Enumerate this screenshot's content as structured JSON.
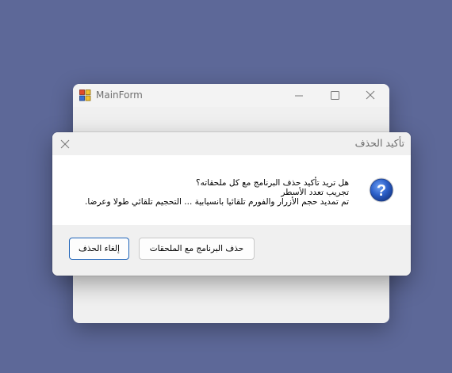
{
  "main_window": {
    "title": "MainForm",
    "icons": {
      "app": "app-icon",
      "minimize": "minimize-icon",
      "maximize": "maximize-icon",
      "close": "close-icon"
    }
  },
  "dialog": {
    "title": "تأكيد الحذف",
    "icon": "question-icon",
    "close_icon": "close-icon",
    "message_lines": [
      "هل تريد تأكيد حذف البرنامج مع كل ملحقاته؟",
      "تجريب تعدد الأسطر",
      "تم تمديد حجم الأزرار والفورم تلقائيا بانسيابية ... التحجيم تلقائي طولا وعرضا."
    ],
    "buttons": {
      "delete_label": "حذف البرنامج مع الملحقات",
      "cancel_label": "إلغاء الحذف"
    }
  },
  "colors": {
    "desktop": "#5d6898",
    "accent_focus": "#1e63b8",
    "question_icon": "#2b5fc8"
  }
}
